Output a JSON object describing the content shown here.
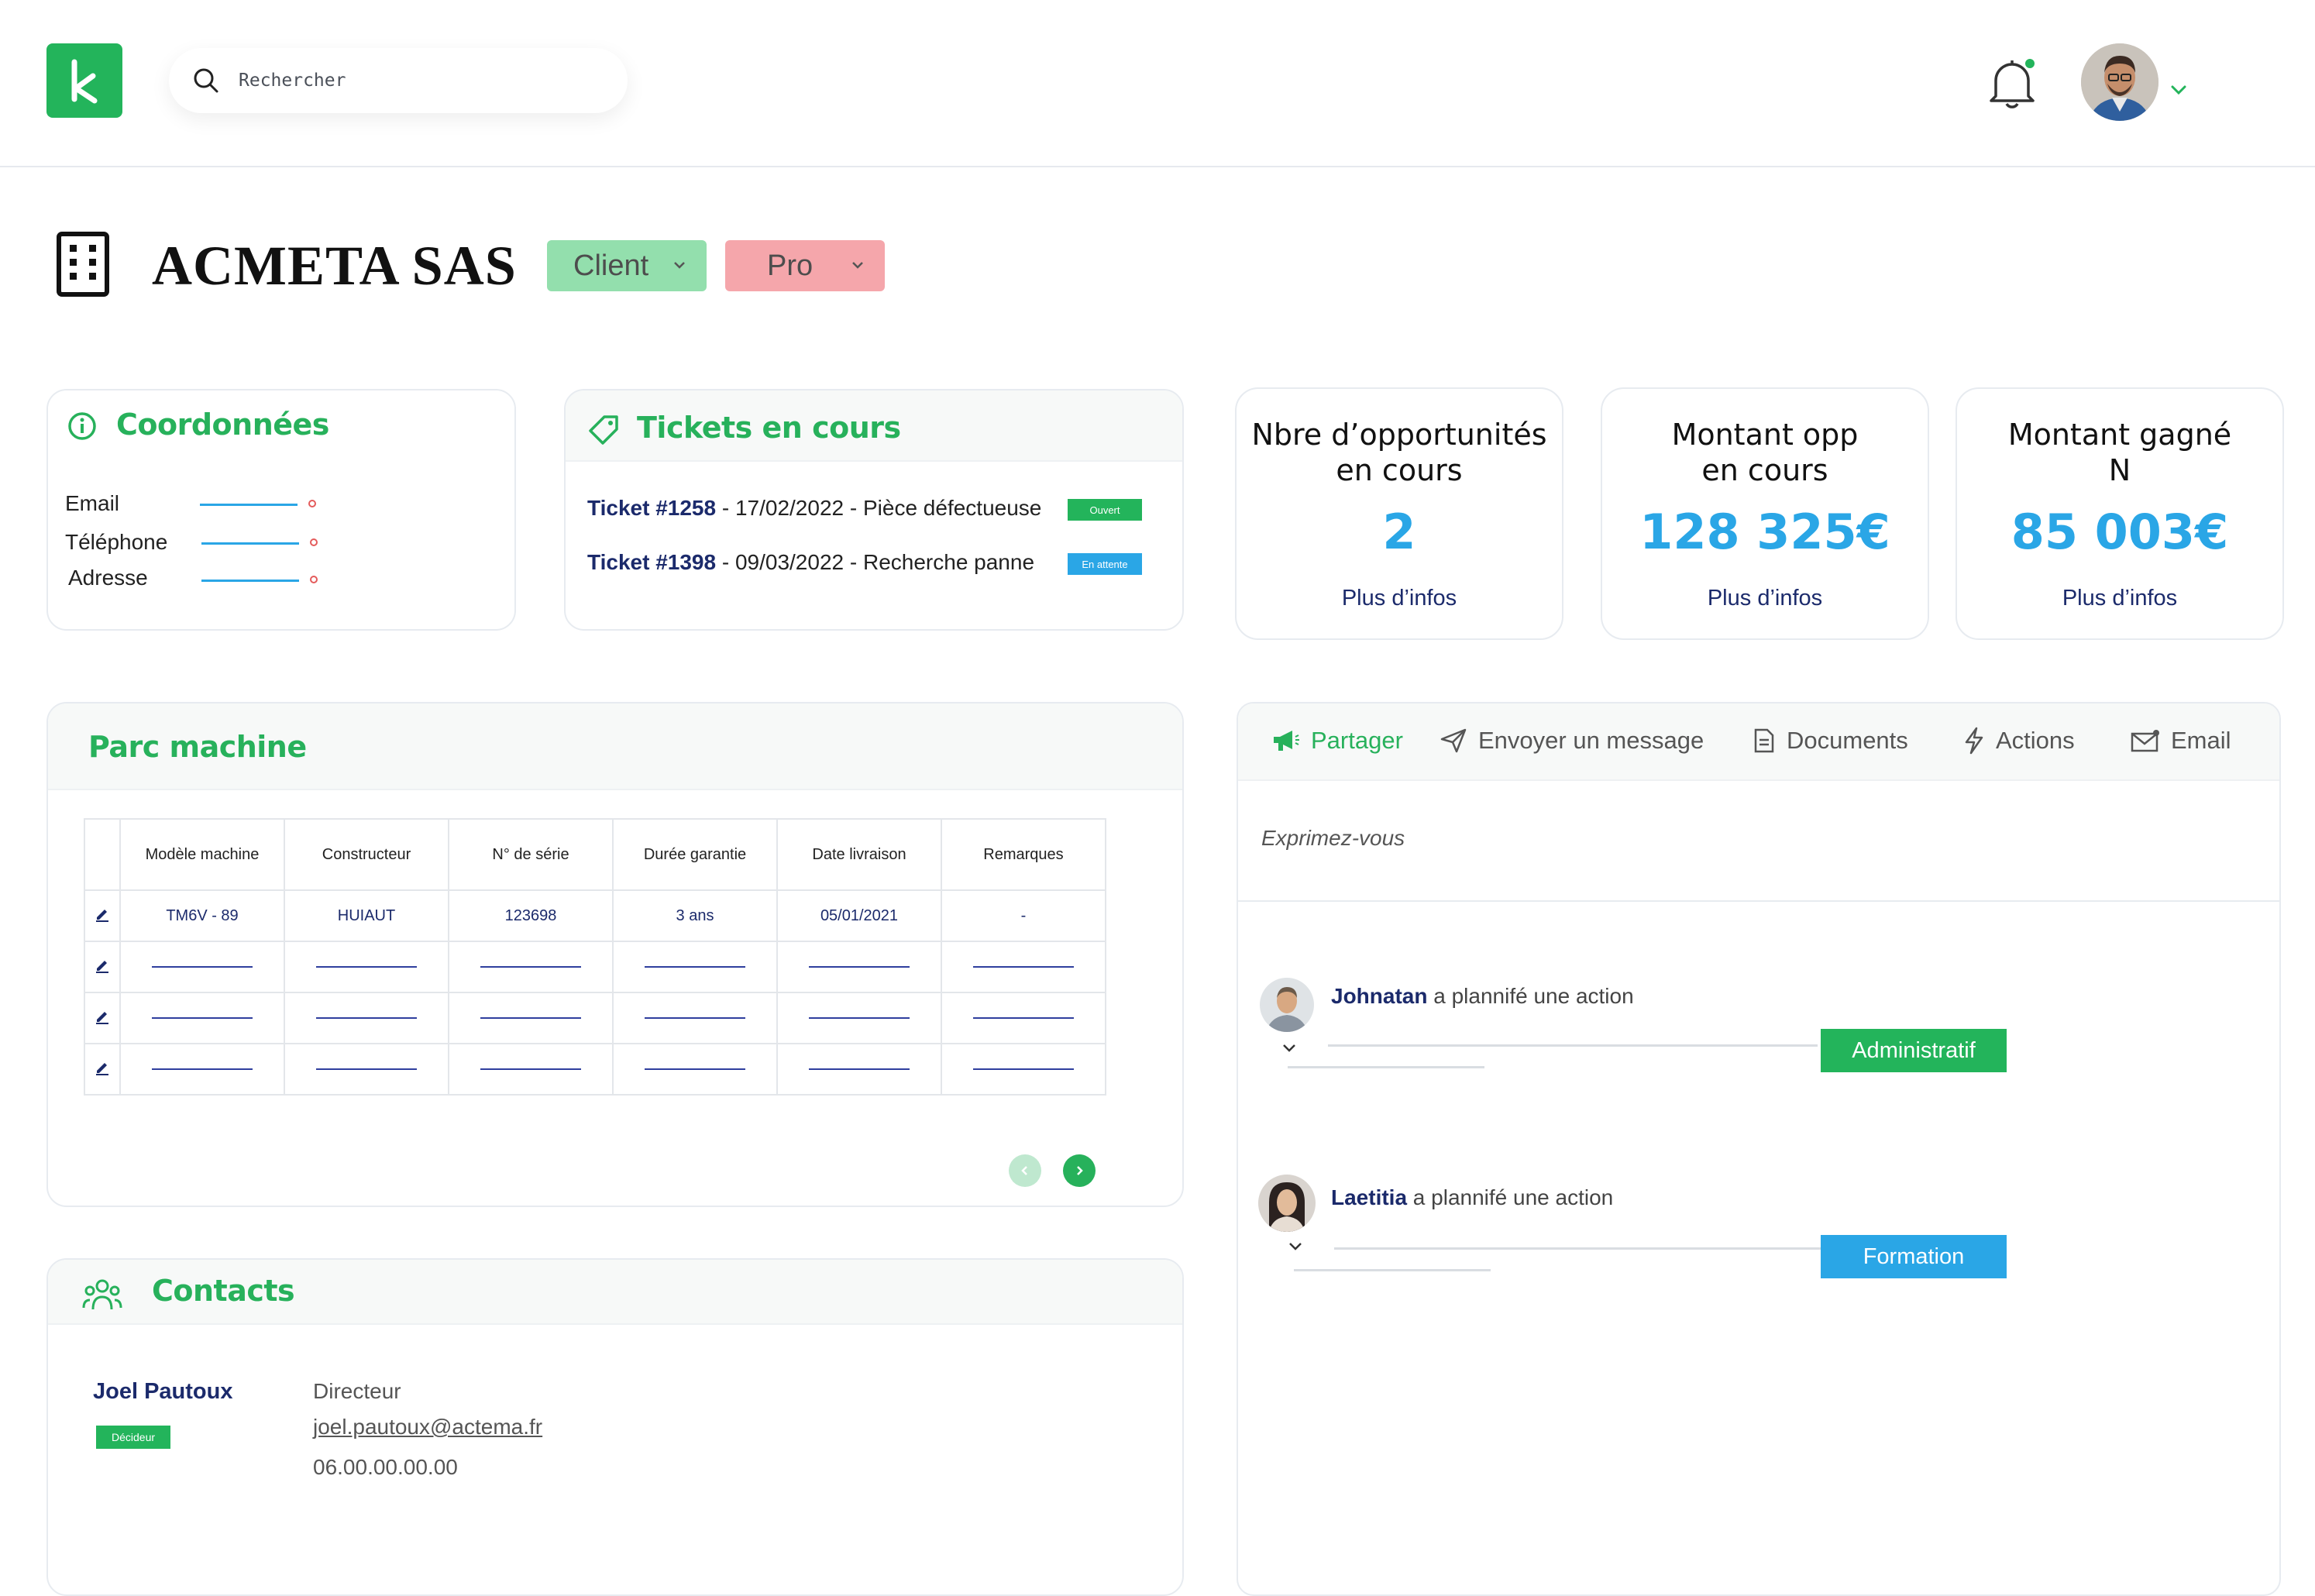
{
  "header": {
    "logo_letter": "k",
    "search_placeholder": "Rechercher"
  },
  "company": {
    "name": "ACMETA SAS",
    "type_label": "Client",
    "segment_label": "Pro"
  },
  "colors": {
    "brand_green": "#23b45b",
    "accent_blue": "#2aa6e6",
    "client_pill": "#93dfad",
    "pro_pill": "#f5a6ab",
    "dark_navy": "#1b2a6b"
  },
  "coordonnees": {
    "title": "Coordonnées",
    "fields": [
      "Email",
      "Téléphone",
      "Adresse"
    ]
  },
  "tickets": {
    "title": "Tickets en cours",
    "items": [
      {
        "label": "Ticket",
        "number": "#1258",
        "detail": " - 17/02/2022 - Pièce défectueuse",
        "status": "Ouvert"
      },
      {
        "label": "Ticket",
        "number": "#1398",
        "detail": " - 09/03/2022 - Recherche panne",
        "status": "En attente"
      }
    ]
  },
  "stats": [
    {
      "title_line1": "Nbre d’opportunités",
      "title_line2": "en cours",
      "value": "2",
      "link": "Plus d’infos"
    },
    {
      "title_line1": "Montant opp",
      "title_line2": "en cours",
      "value": "128 325€",
      "link": "Plus d’infos"
    },
    {
      "title_line1": "Montant gagné",
      "title_line2": "N",
      "value": "85 003€",
      "link": "Plus d’infos"
    }
  ],
  "parc": {
    "title": "Parc machine",
    "columns": [
      "Modèle machine",
      "Constructeur",
      "N° de série",
      "Durée garantie",
      "Date livraison",
      "Remarques"
    ],
    "row1": [
      "TM6V - 89",
      "HUIAUT",
      "123698",
      "3 ans",
      "05/01/2021",
      "-"
    ]
  },
  "contacts": {
    "title": "Contacts",
    "name": "Joel Pautoux",
    "role_badge": "Décideur",
    "position": "Directeur",
    "email": "joel.pautoux@actema.fr",
    "phone": "06.00.00.00.00"
  },
  "feed": {
    "tabs": [
      "Partager",
      "Envoyer un message",
      "Documents",
      "Actions",
      "Email"
    ],
    "composer_placeholder": "Exprimez-vous",
    "activities": [
      {
        "user": "Johnatan",
        "text": " a plannifé une action",
        "tag": "Administratif",
        "tag_color": "#23b45b"
      },
      {
        "user": "Laetitia",
        "text": " a plannifé une action",
        "tag": "Formation",
        "tag_color": "#2aa6e6"
      }
    ]
  }
}
